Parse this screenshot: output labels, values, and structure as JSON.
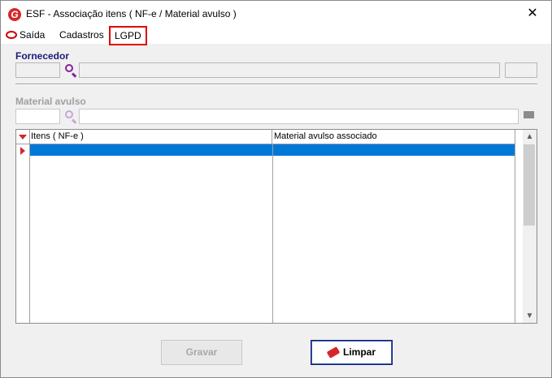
{
  "window": {
    "title": "ESF - Associação itens ( NF-e / Material avulso )",
    "close_glyph": "✕",
    "app_icon_letter": "G"
  },
  "menu": {
    "items": [
      {
        "label": "Saída"
      },
      {
        "label": "Cadastros"
      },
      {
        "label": "LGPD"
      }
    ]
  },
  "fornecedor": {
    "label": "Fornecedor",
    "code_value": "",
    "name_value": "",
    "extra_value": ""
  },
  "material_avulso": {
    "label": "Material avulso",
    "code_value": "",
    "description_value": ""
  },
  "grid": {
    "columns": [
      "Itens ( NF-e )",
      "Material avulso associado"
    ],
    "scroll_up": "▲",
    "scroll_down": "▼"
  },
  "buttons": {
    "gravar_label": "Gravar",
    "limpar_label": "Limpar"
  },
  "colors": {
    "selected_row": "#0078d7",
    "accent_red": "#d7262a",
    "highlight_border": "#e00000"
  }
}
